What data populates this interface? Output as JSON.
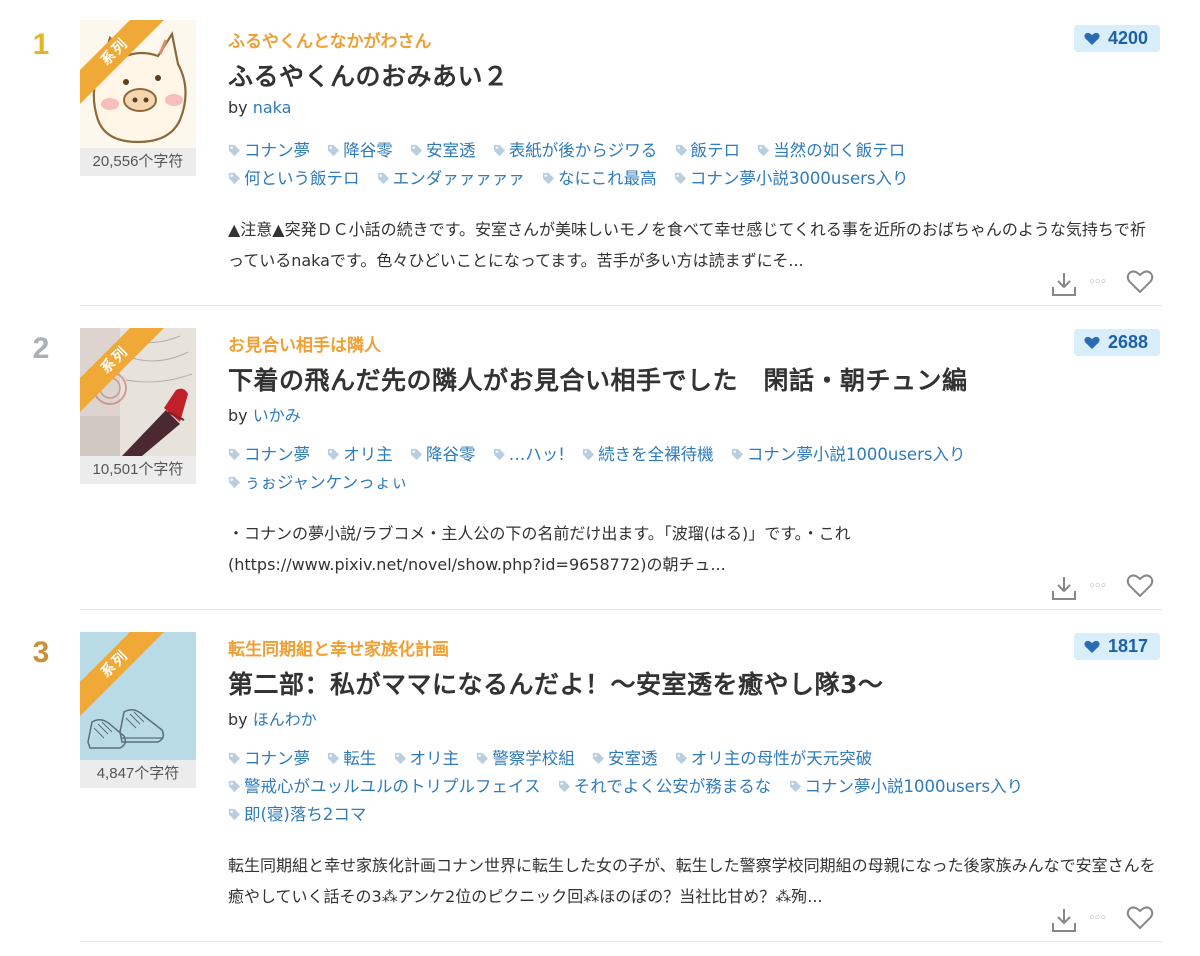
{
  "items": [
    {
      "rank": "1",
      "rank_color": "#e6b422",
      "ribbon": "系列",
      "char_count": "20,556个字符",
      "series": "ふるやくんとなかがわさん",
      "title": "ふるやくんのおみあい２",
      "by": "by",
      "author": "naka",
      "likes": "4200",
      "tags": [
        "コナン夢",
        "降谷零",
        "安室透",
        "表紙が後からジワる",
        "飯テロ",
        "当然の如く飯テロ",
        "何という飯テロ",
        "エンダァァァァァ",
        "なにこれ最高",
        "コナン夢小説3000users入り"
      ],
      "desc": "▲注意▲突発ＤＣ小話の続きです。安室さんが美味しいモノを食べて幸せ感じてくれる事を近所のおばちゃんのような気持ちで祈っているnakaです。色々ひどいことになってます。苦手が多い方は読まずにそ..."
    },
    {
      "rank": "2",
      "rank_color": "#aab0b8",
      "ribbon": "系列",
      "char_count": "10,501个字符",
      "series": "お見合い相手は隣人",
      "title": "下着の飛んだ先の隣人がお見合い相手でした　閑話・朝チュン編",
      "by": "by",
      "author": "いかみ",
      "likes": "2688",
      "tags": [
        "コナン夢",
        "オリ主",
        "降谷零",
        "…ハッ!",
        "続きを全裸待機",
        "コナン夢小説1000users入り",
        "ぅぉジャンケンっょぃ"
      ],
      "desc": "・コナンの夢小説/ラブコメ・主人公の下の名前だけ出ます。「波瑠(はる)」です。・これ(https://www.pixiv.net/novel/show.php?id=9658772)の朝チュ..."
    },
    {
      "rank": "3",
      "rank_color": "#c8913a",
      "ribbon": "系列",
      "char_count": "4,847个字符",
      "series": "転生同期組と幸せ家族化計画",
      "title": "第二部：私がママになるんだよ！〜安室透を癒やし隊3〜",
      "by": "by",
      "author": "ほんわか",
      "likes": "1817",
      "tags": [
        "コナン夢",
        "転生",
        "オリ主",
        "警察学校組",
        "安室透",
        "オリ主の母性が天元突破",
        "警戒心がユッルユルのトリプルフェイス",
        "それでよく公安が務まるな",
        "コナン夢小説1000users入り",
        "即(寝)落ち2コマ"
      ],
      "desc": "転生同期組と幸せ家族化計画コナン世界に転生した女の子が、転生した警察学校同期組の母親になった後家族みんなで安室さんを癒やしていく話その3⁂アンケ2位のピクニック回⁂ほのぼの？当社比甘め？⁂殉..."
    }
  ],
  "colors": {
    "series": "#ef9f33",
    "link": "#2f7bbb",
    "likes_bg": "#d8eefa",
    "likes_text": "#2060a4",
    "ribbon": "#f0a836"
  },
  "icons": {
    "tag": "tag-icon",
    "likes": "heart-icon",
    "download": "download-icon",
    "more": "more-icon",
    "bookmark": "heart-outline-icon"
  },
  "more_glyph": "◦◦◦"
}
